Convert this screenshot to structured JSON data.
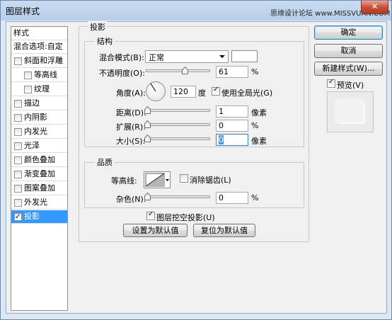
{
  "window": {
    "title": "图层样式",
    "watermark": "思缘设计论坛 www.MISSVUAN.COM",
    "close_glyph": "✕"
  },
  "sidebar": {
    "header": "样式",
    "blend_options": "混合选项:自定",
    "items": [
      {
        "label": "斜面和浮雕",
        "checked": false
      },
      {
        "label": "等高线",
        "checked": false
      },
      {
        "label": "纹理",
        "checked": false
      },
      {
        "label": "描边",
        "checked": false
      },
      {
        "label": "内阴影",
        "checked": false
      },
      {
        "label": "内发光",
        "checked": false
      },
      {
        "label": "光泽",
        "checked": false
      },
      {
        "label": "颜色叠加",
        "checked": false
      },
      {
        "label": "渐变叠加",
        "checked": false
      },
      {
        "label": "图案叠加",
        "checked": false
      },
      {
        "label": "外发光",
        "checked": false
      },
      {
        "label": "投影",
        "checked": true
      }
    ]
  },
  "drop_shadow": {
    "section_title": "投影",
    "structure": {
      "title": "结构",
      "blend_mode_label": "混合模式",
      "blend_mode_key": "(B):",
      "blend_mode_value": "正常",
      "opacity_label": "不透明度",
      "opacity_key": "(O):",
      "opacity_value": "61",
      "opacity_percent": 61,
      "angle_label": "角度",
      "angle_key": "(A):",
      "angle_value": "120",
      "angle_unit": "度",
      "global_light_label": "使用全局光",
      "global_light_key": "(G)",
      "global_light_checked": true,
      "distance_label": "距离",
      "distance_key": "(D):",
      "distance_value": "1",
      "distance_unit": "像素",
      "spread_label": "扩展",
      "spread_key": "(R):",
      "spread_value": "0",
      "spread_unit": "%",
      "size_label": "大小",
      "size_key": "(S):",
      "size_value": "0",
      "size_unit": "像素",
      "percent": "%"
    },
    "quality": {
      "title": "品质",
      "contour_label": "等高线:",
      "antialias_label": "消除锯齿",
      "antialias_key": "(L)",
      "antialias_checked": false,
      "noise_label": "杂色",
      "noise_key": "(N):",
      "noise_value": "0",
      "noise_unit": "%"
    },
    "knockout_label": "图层挖空投影",
    "knockout_key": "(U)",
    "knockout_checked": true,
    "make_default": "设置为默认值",
    "reset_default": "复位为默认值"
  },
  "buttons": {
    "ok": "确定",
    "cancel": "取消",
    "new_style": "新建样式(W)...",
    "preview_label": "预览",
    "preview_key": "(V)",
    "preview_checked": true
  },
  "colors": {
    "accent": "#3399ff",
    "window_frame": "#b7cde9",
    "close": "#c84a32"
  }
}
